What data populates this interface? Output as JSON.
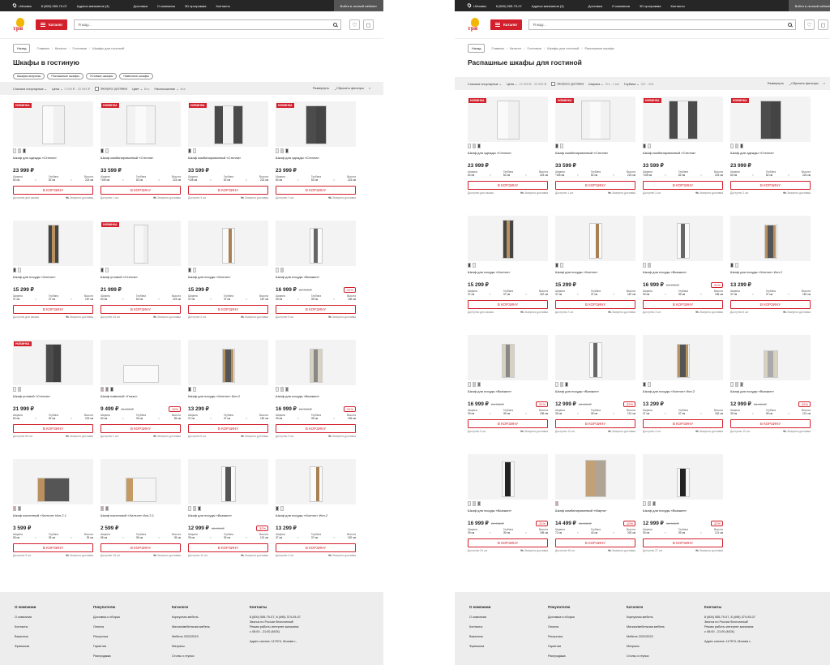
{
  "topbar": {
    "city": "г.Москва",
    "phone": "8 (800) 555-79-07",
    "stores": "Адреса магазинов (3)",
    "links": [
      "Доставка",
      "О компании",
      "3D программа",
      "Контакты"
    ],
    "login": "Войти в личный кабинет"
  },
  "header": {
    "logo": "три",
    "catalog": "Каталог",
    "search_placeholder": "Я ищу..."
  },
  "left": {
    "back": "Назад",
    "crumbs": [
      "Главная",
      "Каталог",
      "Гостиные",
      "Шкафы для гостиной"
    ],
    "title": "Шкафы в гостиную",
    "tags": [
      "Шкафы-витрины",
      "Распашные шкафы",
      "Угловые шкафы",
      "Навесные шкафы"
    ],
    "filters": {
      "sort": "Сначала популярные",
      "price": "Цена",
      "price_val": "2 599 ₽ - 33 599 ₽",
      "express": "Экспресс доставка",
      "color": "Цвет",
      "color_val": "Все",
      "location": "Расположение",
      "location_val": "Все",
      "expand": "Развернуть",
      "reset": "Сбросить фильтры"
    },
    "products": [
      {
        "badge": "НОВИНКА",
        "name": "Шкаф для одежды «Стелла»",
        "price": "23 999 ₽",
        "old": "",
        "disc": "",
        "w": "60 см",
        "d": "52 см",
        "h": "223 см",
        "avail": "Доступно для заказа",
        "kind": "white2",
        "sw": [
          "#eee",
          "#ccc",
          "#444"
        ]
      },
      {
        "badge": "НОВИНКА",
        "name": "Шкаф комбинированный «Стелла»",
        "price": "33 599 ₽",
        "old": "",
        "disc": "",
        "w": "*105 см",
        "d": "52 см",
        "h": "223 см",
        "avail": "Доступно 1 шт.",
        "kind": "white3",
        "sw": [
          "#444",
          "#eee"
        ]
      },
      {
        "badge": "НОВИНКА",
        "name": "Шкаф комбинированный «Стелла»",
        "price": "33 599 ₽",
        "old": "",
        "disc": "",
        "w": "*105 см",
        "d": "52 см",
        "h": "223 см",
        "avail": "Доступно 3 шт.",
        "kind": "dark3",
        "sw": [
          "#444",
          "#eee"
        ]
      },
      {
        "badge": "НОВИНКА",
        "name": "Шкаф для одежды «Стелла»",
        "price": "23 999 ₽",
        "old": "",
        "disc": "",
        "w": "60 см",
        "d": "52 см",
        "h": "223 см",
        "avail": "Доступно 2 шт.",
        "kind": "dark2",
        "sw": [
          "#eee",
          "#ccc",
          "#444"
        ]
      },
      {
        "badge": "",
        "name": "Шкаф для посуды «Хилтон»",
        "price": "15 299 ₽",
        "old": "",
        "disc": "",
        "w": "37 см",
        "d": "37 см",
        "h": "187 см",
        "avail": "Доступно для заказа",
        "kind": "oak",
        "sw": [
          "#444",
          "#eee"
        ]
      },
      {
        "badge": "НОВИНКА",
        "name": "Шкаф угловой «Стелла»",
        "price": "21 999 ₽",
        "old": "",
        "disc": "",
        "w": "60 см",
        "d": "52 см",
        "h": "223 см",
        "avail": "Доступно 33 шт.",
        "kind": "whiteTall",
        "sw": [
          "#444",
          "#eee"
        ]
      },
      {
        "badge": "",
        "name": "Шкаф для посуды «Хилтон»",
        "price": "15 299 ₽",
        "old": "",
        "disc": "",
        "w": "37 см",
        "d": "37 см",
        "h": "187 см",
        "avail": "Доступно 2 шт.",
        "kind": "whiteOak",
        "sw": [
          "#444",
          "#eee"
        ]
      },
      {
        "badge": "",
        "name": "Шкаф для посуды «Вьюжин»",
        "price": "16 999 ₽",
        "old": "24 700 ₽",
        "disc": "-31%",
        "w": "39 см",
        "d": "39 см",
        "h": "196 см",
        "avail": "Доступно 5 шт.",
        "kind": "glassWhite",
        "sw": [
          "#eee",
          "#ccc"
        ]
      },
      {
        "badge": "НОВИНКА",
        "name": "Шкаф угловой «Стелла»",
        "price": "21 999 ₽",
        "old": "",
        "disc": "",
        "w": "60 см",
        "d": "52 см",
        "h": "223 см",
        "avail": "Доступно 65 шт.",
        "kind": "dark1",
        "sw": [
          "#eee",
          "#ccc"
        ]
      },
      {
        "badge": "",
        "name": "Шкаф навесной «Глазо»",
        "price": "9 499 ₽",
        "old": "11 100 ₽",
        "disc": "-15%",
        "w": "60 см",
        "d": "33 см",
        "h": "55 см",
        "avail": "Доступно 2 шт.",
        "kind": "wall",
        "sw": [
          "#caa",
          "#888",
          "#444"
        ]
      },
      {
        "badge": "",
        "name": "Шкаф для посуды «Хилтон» Исп.2",
        "price": "13 299 ₽",
        "old": "",
        "disc": "",
        "w": "37 см",
        "d": "37 см",
        "h": "152 см",
        "avail": "Доступно 6 шт.",
        "kind": "oakGlass",
        "sw": [
          "#444",
          "#eee"
        ]
      },
      {
        "badge": "",
        "name": "Шкаф для посуды «Вьюжин»",
        "price": "16 999 ₽",
        "old": "24 700 ₽",
        "disc": "-31%",
        "w": "39 см",
        "d": "39 см",
        "h": "196 см",
        "avail": "Доступно 3 шт.",
        "kind": "beigeGlass",
        "sw": [
          "#eee",
          "#ccc",
          "#777"
        ]
      },
      {
        "badge": "",
        "name": "Шкаф настенный «Хилтон» Исп.2.1",
        "price": "3 599 ₽",
        "old": "",
        "disc": "",
        "w": "55 см",
        "d": "35 см",
        "h": "39 см",
        "avail": "Доступно 5 шт.",
        "kind": "boxDark",
        "sw": [
          "#caa",
          "#888"
        ]
      },
      {
        "badge": "",
        "name": "Шкаф настенный «Хилтон» Исп.2.1",
        "price": "2 599 ₽",
        "old": "",
        "disc": "",
        "w": "55 см",
        "d": "35 см",
        "h": "39 см",
        "avail": "Доступно 18 шт.",
        "kind": "boxWhite",
        "sw": [
          "#caa",
          "#888"
        ]
      },
      {
        "badge": "",
        "name": "Шкаф для посуды «Вьюжин»",
        "price": "12 999 ₽",
        "old": "18 000 ₽",
        "disc": "-32%",
        "w": "39 см",
        "d": "39 см",
        "h": "121 см",
        "avail": "Доступно 10 шт.",
        "kind": "whiteShort",
        "sw": [
          "#eee",
          "#ccc",
          "#444"
        ]
      },
      {
        "badge": "",
        "name": "Шкаф для посуды «Хилтон» Исп.2",
        "price": "13 299 ₽",
        "old": "",
        "disc": "",
        "w": "37 см",
        "d": "37 см",
        "h": "152 см",
        "avail": "Доступно 4 шт.",
        "kind": "whiteOak",
        "sw": [
          "#444",
          "#eee"
        ]
      }
    ]
  },
  "right": {
    "back": "Назад",
    "crumbs": [
      "Главная",
      "Каталог",
      "Гостиные",
      "Шкафы для гостиной",
      "Распашные шкафы"
    ],
    "title": "Распашные шкафы для гостиной",
    "filters": {
      "sort": "Сначала популярные",
      "price": "Цена",
      "price_val": "12 999 ₽ - 33 599 ₽",
      "express": "Экспресс доставка",
      "width": "Ширина",
      "width_val": "37к - 1 м8",
      "depth": "Глубина",
      "depth_val": "357 - 526",
      "expand": "Развернуть",
      "reset": "Сбросить фильтры"
    },
    "products": [
      {
        "badge": "НОВИНКА",
        "name": "Шкаф для одежды «Стелла»",
        "price": "23 999 ₽",
        "old": "",
        "disc": "",
        "w": "60 см",
        "d": "52 см",
        "h": "223 см",
        "avail": "Доступно для заказа",
        "kind": "white2",
        "sw": [
          "#eee",
          "#ccc",
          "#444"
        ]
      },
      {
        "badge": "НОВИНКА",
        "name": "Шкаф комбинированный «Стелла»",
        "price": "33 599 ₽",
        "old": "",
        "disc": "",
        "w": "*105 см",
        "d": "52 см",
        "h": "223 см",
        "avail": "Доступно 1 шт.",
        "kind": "white3",
        "sw": [
          "#444",
          "#eee"
        ]
      },
      {
        "badge": "НОВИНКА",
        "name": "Шкаф комбинированный «Стелла»",
        "price": "33 599 ₽",
        "old": "",
        "disc": "",
        "w": "*105 см",
        "d": "52 см",
        "h": "223 см",
        "avail": "Доступно 3 шт.",
        "kind": "dark3",
        "sw": [
          "#444",
          "#eee"
        ]
      },
      {
        "badge": "НОВИНКА",
        "name": "Шкаф для одежды «Стелла»",
        "price": "23 999 ₽",
        "old": "",
        "disc": "",
        "w": "60 см",
        "d": "52 см",
        "h": "223 см",
        "avail": "Доступно 2 шт.",
        "kind": "dark2",
        "sw": [
          "#eee",
          "#ccc",
          "#444"
        ]
      },
      {
        "badge": "",
        "name": "Шкаф для посуды «Хилтон»",
        "price": "15 299 ₽",
        "old": "",
        "disc": "",
        "w": "37 см",
        "d": "37 см",
        "h": "187 см",
        "avail": "Доступно для заказа",
        "kind": "oak",
        "sw": [
          "#444",
          "#eee"
        ]
      },
      {
        "badge": "",
        "name": "Шкаф для посуды «Хилтон»",
        "price": "15 299 ₽",
        "old": "",
        "disc": "",
        "w": "37 см",
        "d": "37 см",
        "h": "187 см",
        "avail": "Доступно 2 шт.",
        "kind": "whiteOak",
        "sw": [
          "#444",
          "#eee"
        ]
      },
      {
        "badge": "",
        "name": "Шкаф для посуды «Вьюжин»",
        "price": "16 999 ₽",
        "old": "24 700 ₽",
        "disc": "-31%",
        "w": "39 см",
        "d": "39 см",
        "h": "196 см",
        "avail": "Доступно 3 шт.",
        "kind": "glassWhite",
        "sw": [
          "#eee",
          "#ccc"
        ]
      },
      {
        "badge": "",
        "name": "Шкаф для посуды «Хилтон» Исп.2",
        "price": "13 299 ₽",
        "old": "",
        "disc": "",
        "w": "37 см",
        "d": "37 см",
        "h": "152 см",
        "avail": "Доступно 6 шт.",
        "kind": "oakGlass",
        "sw": [
          "#444",
          "#eee"
        ]
      },
      {
        "badge": "",
        "name": "Шкаф для посуды «Вьюжин»",
        "price": "16 999 ₽",
        "old": "24 700 ₽",
        "disc": "-31%",
        "w": "39 см",
        "d": "39 см",
        "h": "196 см",
        "avail": "Доступно 5 шт.",
        "kind": "beigeGlass",
        "sw": [
          "#eee",
          "#ccc",
          "#777"
        ]
      },
      {
        "badge": "",
        "name": "Шкаф для посуды «Вьюжин»",
        "price": "12 999 ₽",
        "old": "18 000 ₽",
        "disc": "-32%",
        "w": "39 см",
        "d": "39 см",
        "h": "121 см",
        "avail": "Доступно 13 шт.",
        "kind": "glassWhite",
        "sw": [
          "#eee",
          "#ccc",
          "#444"
        ]
      },
      {
        "badge": "",
        "name": "Шкаф для посуды «Хилтон» Исп.2",
        "price": "13 299 ₽",
        "old": "",
        "disc": "",
        "w": "37 см",
        "d": "37 см",
        "h": "152 см",
        "avail": "Доступно 4 шт.",
        "kind": "oakGlass",
        "sw": [
          "#444",
          "#eee"
        ]
      },
      {
        "badge": "",
        "name": "Шкаф для посуды «Вьюжин»",
        "price": "12 999 ₽",
        "old": "18 000 ₽",
        "disc": "-32%",
        "w": "39 см",
        "d": "39 см",
        "h": "121 см",
        "avail": "Доступно 10 шт.",
        "kind": "beigeShort",
        "sw": [
          "#eee",
          "#ccc",
          "#777"
        ]
      },
      {
        "badge": "",
        "name": "Шкаф для посуды «Вьюжин»",
        "price": "16 999 ₽",
        "old": "24 700 ₽",
        "disc": "-31%",
        "w": "39 см",
        "d": "39 см",
        "h": "196 см",
        "avail": "Доступно 24 шт.",
        "kind": "blackWhite",
        "sw": [
          "#eee",
          "#ccc",
          "#777"
        ]
      },
      {
        "badge": "",
        "name": "Шкаф комбинированный «Марта»",
        "price": "14 499 ₽",
        "old": "16 000 ₽",
        "disc": "-10%",
        "w": "72 см",
        "d": "43 см",
        "h": "200 см",
        "avail": "Доступно 45 шт.",
        "kind": "marta",
        "sw": [
          "#caa"
        ]
      },
      {
        "badge": "",
        "name": "Шкаф для посуды «Вьюжин»",
        "price": "12 999 ₽",
        "old": "18 000 ₽",
        "disc": "-32%",
        "w": "39 см",
        "d": "39 см",
        "h": "121 см",
        "avail": "Доступно 27 шт.",
        "kind": "blackShort",
        "sw": [
          "#eee",
          "#ccc",
          "#777"
        ]
      }
    ]
  },
  "labels": {
    "width": "Ширина",
    "depth": "Глубина",
    "height": "Высота",
    "cart": "В КОРЗИНУ",
    "express": "Экспресс доставка",
    "x": "×"
  },
  "footer": {
    "col1": {
      "title": "О компании",
      "items": [
        "О компании",
        "Контакты",
        "Вакансии",
        "Франшиза"
      ]
    },
    "col2": {
      "title": "Покупателю",
      "items": [
        "Доставка и сборка",
        "Оплата",
        "Рассрочка",
        "Гарантии",
        "Распродажа"
      ]
    },
    "col3": {
      "title": "Каталоги",
      "items": [
        "Корпусная мебель",
        "Мягкая/мебельная мебель",
        "Мебель 2022/2023",
        "Матрасы",
        "Столы и стулья"
      ]
    },
    "col4": {
      "title": "Контакты",
      "items": [
        "8 (800) 555-79-07, 8 (495) 374-93-07",
        "Звонок по России бесплатный!",
        "Режим работы интернет-магазина:",
        "с 08:00 - 21:00 (МСК)",
        "Адрес салона: 117574, Москва г.,"
      ]
    }
  }
}
